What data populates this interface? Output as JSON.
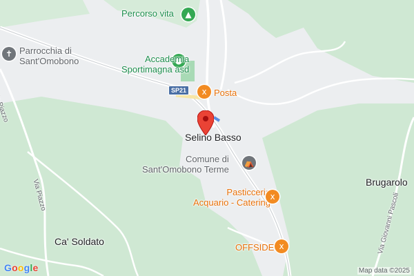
{
  "map": {
    "labels": {
      "percorso_vita": "Percorso vita",
      "parrocchia": "Parrocchia di\nSant'Omobono",
      "accademia": "Accademia\nSportimagna asd",
      "posta": "Posta",
      "selino_basso": "Selino Basso",
      "comune": "Comune di\nSant'Omobono Terme",
      "pasticceria": "Pasticceria\nAcquario - Catering",
      "brugarolo": "Brugarolo",
      "ca_soldato": "Ca' Soldato",
      "offside": "OFFSIDE",
      "via_piazzo_1": "Via Piazzo",
      "via_piazzo_2": "Via Piazzo",
      "via_giovanni": "Via Giovanni Pascoli",
      "road_shield": "SP21"
    },
    "footer": {
      "map_data": "Map data ©2025",
      "logo_letters": [
        "G",
        "o",
        "o",
        "g",
        "l",
        "e"
      ]
    },
    "icons": {
      "tree": "tree-icon",
      "church": "church-icon",
      "sport": "sport-icon",
      "restaurant": "restaurant-icon",
      "government": "government-icon",
      "marker": "location-marker-icon"
    },
    "colors": {
      "forest": "#cfe8d3",
      "background": "#eceef0",
      "road": "#ffffff",
      "poi_green": "#34a853",
      "poi_orange": "#f28b22",
      "marker_red": "#ea4335"
    }
  }
}
